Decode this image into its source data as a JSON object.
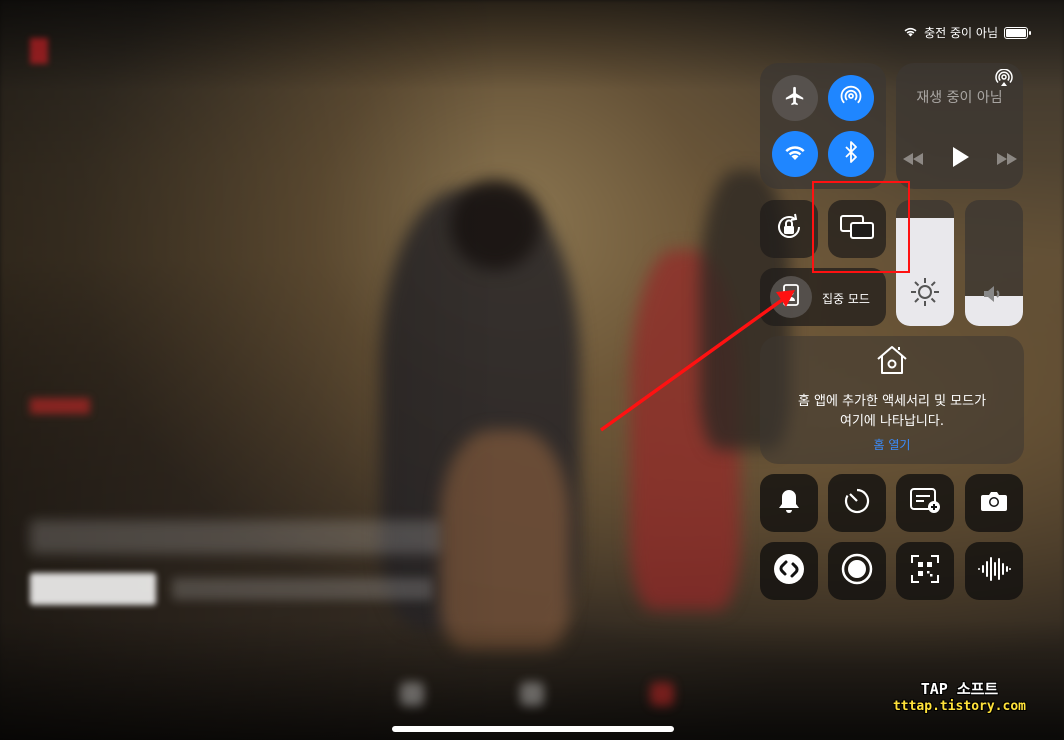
{
  "status_bar": {
    "text": "충전 중이 아님",
    "battery_level": 1.0
  },
  "now_playing": {
    "title": "재생 중이 아님"
  },
  "focus": {
    "label": "집중 모드"
  },
  "home": {
    "text_line1": "홈 앱에 추가한 액세서리 및 모드가",
    "text_line2": "여기에 나타납니다.",
    "link": "홈 열기"
  },
  "sliders": {
    "brightness_level": 0.86,
    "volume_level": 0.24
  },
  "watermark": {
    "title": "TAP 소프트",
    "url": "tttap.tistory.com"
  },
  "colors": {
    "accent_blue": "#1f86ff",
    "annotation_red": "#ff1111",
    "slider_fill": "#e9e8ec"
  },
  "icons": [
    "airplane-mode-icon",
    "airdrop-icon",
    "wifi-icon",
    "bluetooth-icon",
    "airplay-icon",
    "rewind-icon",
    "play-icon",
    "fast-forward-icon",
    "rotation-lock-icon",
    "screen-mirroring-icon",
    "focus-mode-icon",
    "brightness-icon",
    "volume-icon",
    "home-icon",
    "bell-icon",
    "timer-icon",
    "quick-note-icon",
    "camera-icon",
    "shazam-icon",
    "screen-record-icon",
    "qr-code-scanner-icon",
    "sound-recognition-icon"
  ]
}
